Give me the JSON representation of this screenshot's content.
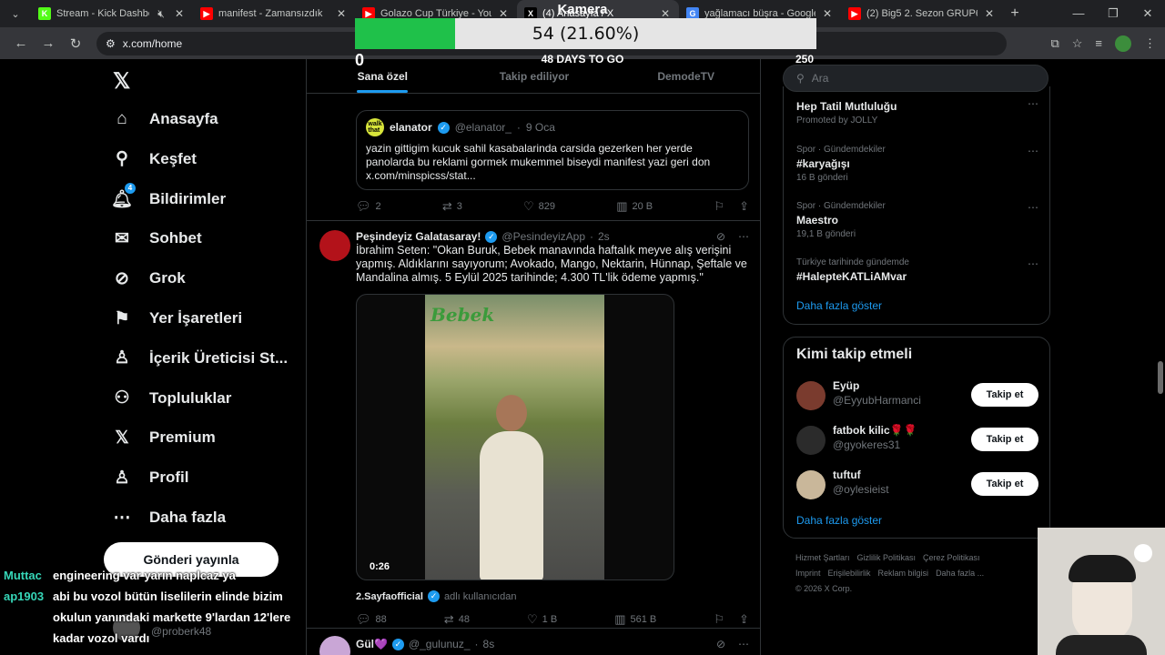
{
  "browser": {
    "tabs": [
      {
        "title": "Stream - Kick Dashboard",
        "fav_color": "#53fc18",
        "fav_text": "K",
        "muted": true
      },
      {
        "title": "manifest - Zamansızdık",
        "fav_color": "#ff0000",
        "fav_text": "▶",
        "muted": false
      },
      {
        "title": "Golazo Cup Türkiye - YouT",
        "fav_color": "#ff0000",
        "fav_text": "▶",
        "muted": false
      },
      {
        "title": "(4) Anasayfa / X",
        "fav_color": "#000000",
        "fav_text": "X",
        "muted": false
      },
      {
        "title": "yağlamacı büşra - Google'd",
        "fav_color": "#4285f4",
        "fav_text": "G",
        "muted": false
      },
      {
        "title": "(2) Big5 2. Sezon GRUP6 Sa",
        "fav_color": "#ff0000",
        "fav_text": "▶",
        "muted": false
      }
    ],
    "url": "x.com/home"
  },
  "overlay": {
    "title": "Kamera",
    "progress_text": "54 (21.60%)",
    "progress_fraction": 0.216,
    "start": "0",
    "end": "250",
    "days_label": "48 DAYS TO GO"
  },
  "nav": {
    "items": [
      {
        "label": "Anasayfa",
        "icon": "home-icon",
        "glyph": "⌂"
      },
      {
        "label": "Keşfet",
        "icon": "search-icon",
        "glyph": "⚲"
      },
      {
        "label": "Bildirimler",
        "icon": "bell-icon",
        "glyph": "🔔︎"
      },
      {
        "label": "Sohbet",
        "icon": "mail-icon",
        "glyph": "✉"
      },
      {
        "label": "Grok",
        "icon": "grok-icon",
        "glyph": "⊘"
      },
      {
        "label": "Yer İşaretleri",
        "icon": "bookmark-icon",
        "glyph": "⚑"
      },
      {
        "label": "İçerik Üreticisi St...",
        "icon": "creator-icon",
        "glyph": "♙"
      },
      {
        "label": "Topluluklar",
        "icon": "communities-icon",
        "glyph": "⚇"
      },
      {
        "label": "Premium",
        "icon": "x-icon",
        "glyph": "𝕏"
      },
      {
        "label": "Profil",
        "icon": "profile-icon",
        "glyph": "♙"
      },
      {
        "label": "Daha fazla",
        "icon": "more-icon",
        "glyph": "⋯"
      }
    ],
    "notif_badge": "4",
    "post_button": "Gönderi yayınla"
  },
  "feed": {
    "tabs": [
      "Sana özel",
      "Takip ediliyor",
      "DemodeTV"
    ],
    "quote": {
      "name": "elanator",
      "handle": "@elanator_",
      "date": "9 Oca",
      "text": "yazin gittigim kucuk sahil kasabalarinda carsida gezerken her yerde panolarda bu reklami gormek mukemmel biseydi manifest yazi geri don x.com/minspicss/stat..."
    },
    "post1_actions": {
      "reply": "2",
      "repost": "3",
      "like": "829",
      "views": "20 B"
    },
    "post2": {
      "name": "Peşindeyiz Galatasaray!",
      "handle": "@PesindeyizApp",
      "time": "2s",
      "text": "İbrahim Seten: \"Okan Buruk, Bebek manavında haftalık meyve alış verişini yapmış. Aldıklarını sayıyorum; Avokado, Mango, Nektarin, Hünnap, Şeftale ve Mandalina almış. 5 Eylül 2025 tarihinde; 4.300 TL'lik ödeme yapmış.\"",
      "video_duration": "0:26",
      "video_sign": "Bebek",
      "credit_name": "2.Sayfaofficial",
      "credit_suffix": "adlı kullanıcıdan",
      "actions": {
        "reply": "88",
        "repost": "48",
        "like": "1 B",
        "views": "561 B"
      }
    },
    "post3": {
      "name": "Gül💜",
      "handle": "@_gulunuz_",
      "time": "8s"
    }
  },
  "sidebar": {
    "search_placeholder": "Ara",
    "trends": [
      {
        "meta": "",
        "name": "Hep Tatil Mutluluğu",
        "count": "Promoted by JOLLY"
      },
      {
        "meta": "Spor · Gündemdekiler",
        "name": "#karyağışı",
        "count": "16 B gönderi"
      },
      {
        "meta": "Spor · Gündemdekiler",
        "name": "Maestro",
        "count": "19,1 B gönderi"
      },
      {
        "meta": "Türkiye tarihinde gündemde",
        "name": "#HalepteKATLiAMvar",
        "count": ""
      }
    ],
    "show_more": "Daha fazla göster",
    "who_title": "Kimi takip etmeli",
    "who": [
      {
        "name": "Eyüp",
        "handle": "@EyyubHarmanci",
        "button": "Takip et"
      },
      {
        "name": "fatbok kilic🌹🌹",
        "handle": "@gyokeres31",
        "button": "Takip et"
      },
      {
        "name": "tuftuf",
        "handle": "@oylesieist",
        "button": "Takip et"
      }
    ],
    "footer": [
      "Hizmet Şartları",
      "Gizlilik Politikası",
      "Çerez Politikası",
      "Imprint",
      "Erişilebilirlik",
      "Reklam bilgisi",
      "Daha fazla ...",
      "© 2026 X Corp."
    ]
  },
  "chat": [
    {
      "user": "Muttac",
      "msg": "engineering var yarın naplcaz ya"
    },
    {
      "user": "ap1903",
      "msg": "abi bu vozol bütün liselilerin elinde bizim"
    },
    {
      "user": "",
      "msg": "okulun yanındaki markette 9'lardan 12'lere"
    },
    {
      "user": "",
      "msg": "kadar vozol vardı"
    }
  ],
  "chat_partial_handle": "@proberk48"
}
